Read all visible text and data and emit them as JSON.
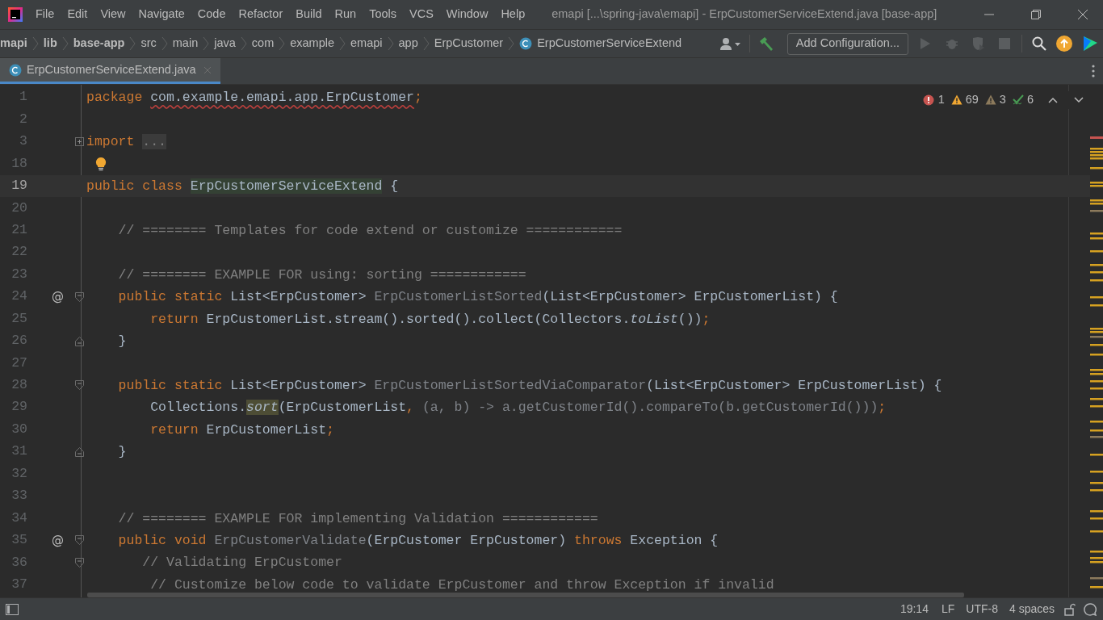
{
  "menu": [
    "File",
    "Edit",
    "View",
    "Navigate",
    "Code",
    "Refactor",
    "Build",
    "Run",
    "Tools",
    "VCS",
    "Window",
    "Help"
  ],
  "window": {
    "title": "emapi [...\\spring-java\\emapi] - ErpCustomerServiceExtend.java [base-app]"
  },
  "breadcrumbs": [
    {
      "label": "mapi",
      "kind": "module"
    },
    {
      "label": "lib",
      "kind": "module"
    },
    {
      "label": "base-app",
      "kind": "module"
    },
    {
      "label": "src",
      "kind": "folder"
    },
    {
      "label": "main",
      "kind": "folder"
    },
    {
      "label": "java",
      "kind": "folder"
    },
    {
      "label": "com",
      "kind": "folder"
    },
    {
      "label": "example",
      "kind": "folder"
    },
    {
      "label": "emapi",
      "kind": "folder"
    },
    {
      "label": "app",
      "kind": "folder"
    },
    {
      "label": "ErpCustomer",
      "kind": "folder"
    },
    {
      "label": "ErpCustomerServiceExtend",
      "kind": "class"
    }
  ],
  "toolbar": {
    "run_config": "Add Configuration..."
  },
  "tabs": [
    {
      "label": "ErpCustomerServiceExtend.java",
      "selected": true
    }
  ],
  "inspections": {
    "errors": "1",
    "warnings": "69",
    "weak_warnings": "3",
    "typos": "6"
  },
  "lines": [
    {
      "number": "1",
      "tokens": [
        {
          "kind": "kw",
          "text": "package "
        },
        {
          "kind": "squiggle",
          "text": "com.example.emapi.app.ErpCustomer"
        },
        {
          "kind": "kw",
          "text": ";"
        }
      ]
    },
    {
      "number": "2"
    },
    {
      "number": "3",
      "gutter": {
        "kind": "fold-closed"
      },
      "tokens": [
        {
          "kind": "kw",
          "text": "import "
        },
        {
          "kind": "folded",
          "text": "..."
        }
      ]
    },
    {
      "number": "18",
      "gutter": {
        "kind": "bulb"
      }
    },
    {
      "number": "19",
      "current": true,
      "tokens": [
        {
          "kind": "kw",
          "text": "public class "
        },
        {
          "kind": "usage",
          "text": "ErpCustomerServiceExtend"
        },
        {
          "kind": "text",
          "text": " {"
        }
      ]
    },
    {
      "number": "20"
    },
    {
      "number": "21",
      "tokens": [
        {
          "kind": "comment",
          "text": "    // ======== Templates for code extend or customize ============"
        }
      ]
    },
    {
      "number": "22"
    },
    {
      "number": "23",
      "tokens": [
        {
          "kind": "comment",
          "text": "    // ======== EXAMPLE FOR using: sorting ============"
        }
      ]
    },
    {
      "number": "24",
      "marker": "@",
      "gutter": {
        "kind": "fold-open"
      },
      "tokens": [
        {
          "kind": "kw",
          "text": "    public static "
        },
        {
          "kind": "text",
          "text": "List<ErpCustomer> "
        },
        {
          "kind": "dim",
          "text": "ErpCustomerListSorted"
        },
        {
          "kind": "text",
          "text": "(List<ErpCustomer> ErpCustomerList) {"
        }
      ]
    },
    {
      "number": "25",
      "tokens": [
        {
          "kind": "kw",
          "text": "        return "
        },
        {
          "kind": "text",
          "text": "ErpCustomerList.stream().sorted().collect(Collectors."
        },
        {
          "kind": "italic",
          "text": "toList"
        },
        {
          "kind": "text",
          "text": "())"
        },
        {
          "kind": "kw",
          "text": ";"
        }
      ]
    },
    {
      "number": "26",
      "gutter": {
        "kind": "fold-end"
      },
      "tokens": [
        {
          "kind": "text",
          "text": "    }"
        }
      ]
    },
    {
      "number": "27"
    },
    {
      "number": "28",
      "gutter": {
        "kind": "fold-open"
      },
      "tokens": [
        {
          "kind": "kw",
          "text": "    public static "
        },
        {
          "kind": "text",
          "text": "List<ErpCustomer> "
        },
        {
          "kind": "dim",
          "text": "ErpCustomerListSortedViaComparator"
        },
        {
          "kind": "text",
          "text": "(List<ErpCustomer> ErpCustomerList) {"
        }
      ]
    },
    {
      "number": "29",
      "tokens": [
        {
          "kind": "text",
          "text": "        Collections."
        },
        {
          "kind": "match",
          "text": "sort"
        },
        {
          "kind": "text",
          "text": "(ErpCustomerList"
        },
        {
          "kind": "kw",
          "text": ", "
        },
        {
          "kind": "dim",
          "text": "(a, b) -> "
        },
        {
          "kind": "dim",
          "text": "a.getCustomerId().compareTo(b.getCustomerId()))"
        },
        {
          "kind": "kw",
          "text": ";"
        }
      ]
    },
    {
      "number": "30",
      "tokens": [
        {
          "kind": "kw",
          "text": "        return "
        },
        {
          "kind": "text",
          "text": "ErpCustomerList"
        },
        {
          "kind": "kw",
          "text": ";"
        }
      ]
    },
    {
      "number": "31",
      "gutter": {
        "kind": "fold-end"
      },
      "tokens": [
        {
          "kind": "text",
          "text": "    }"
        }
      ]
    },
    {
      "number": "32"
    },
    {
      "number": "33"
    },
    {
      "number": "34",
      "tokens": [
        {
          "kind": "comment",
          "text": "    // ======== EXAMPLE FOR implementing Validation ============"
        }
      ]
    },
    {
      "number": "35",
      "marker": "@",
      "gutter": {
        "kind": "fold-open"
      },
      "tokens": [
        {
          "kind": "kw",
          "text": "    public void "
        },
        {
          "kind": "dim",
          "text": "ErpCustomerValidate"
        },
        {
          "kind": "text",
          "text": "(ErpCustomer ErpCustomer) "
        },
        {
          "kind": "kw",
          "text": "throws "
        },
        {
          "kind": "text",
          "text": "Exception {"
        }
      ]
    },
    {
      "number": "36",
      "gutter": {
        "kind": "fold-open"
      },
      "tokens": [
        {
          "kind": "comment",
          "text": "       // Validating ErpCustomer"
        }
      ]
    },
    {
      "number": "37",
      "tokens": [
        {
          "kind": "comment",
          "text": "        // Customize below code to validate ErpCustomer and throw Exception if invalid"
        }
      ]
    }
  ],
  "status_bar": {
    "position": "19:14",
    "line_separator": "LF",
    "encoding": "UTF-8",
    "indent": "4 spaces"
  }
}
